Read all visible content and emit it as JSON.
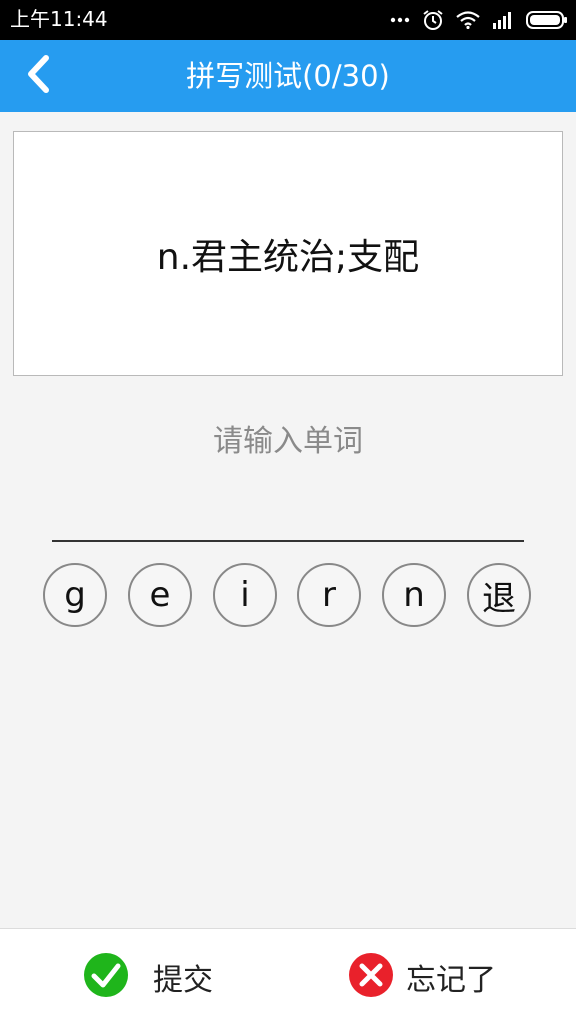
{
  "status_bar": {
    "time": "上午11:44",
    "icons": [
      "more-dots-icon",
      "alarm-icon",
      "wifi-icon",
      "signal-icon",
      "battery-icon"
    ]
  },
  "header": {
    "back_icon": "chevron-left-icon",
    "title": "拼写测试(0/30)",
    "background_color": "#269cf0"
  },
  "card": {
    "definition": "n.君主统治;支配"
  },
  "prompt": "请输入单词",
  "keyboard": {
    "letters": [
      "g",
      "e",
      "i",
      "r",
      "n"
    ],
    "backspace_label": "退"
  },
  "bottom_bar": {
    "submit_label": "提交",
    "submit_icon": "check-circle-icon",
    "submit_color": "#1fb51b",
    "forgot_label": "忘记了",
    "forgot_icon": "close-circle-icon",
    "forgot_color": "#e9212b"
  }
}
